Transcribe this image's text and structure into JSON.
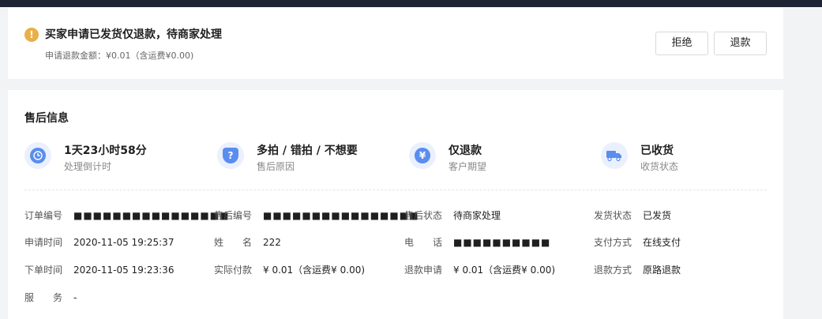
{
  "alert": {
    "title": "买家申请已发货仅退款，待商家处理",
    "amount": "申请退款金额：¥0.01（含运费¥0.00)",
    "reject_label": "拒绝",
    "refund_label": "退款"
  },
  "info": {
    "title": "售后信息",
    "stats": [
      {
        "main": "1天23小时58分",
        "sub": "处理倒计时",
        "icon": "clock-icon"
      },
      {
        "main": "多拍 / 错拍 / 不想要",
        "sub": "售后原因",
        "icon": "shield-question-icon"
      },
      {
        "main": "仅退款",
        "sub": "客户期望",
        "icon": "yuan-refund-icon"
      },
      {
        "main": "已收货",
        "sub": "收货状态",
        "icon": "truck-icon"
      }
    ],
    "fields": {
      "order_no": {
        "label": "订单编号",
        "value": "■■■■■■■■■■■■■■■■"
      },
      "aftersale_no": {
        "label": "售后编号",
        "value": "■■■■■■■■■■■■■■■■"
      },
      "aftersale_status": {
        "label": "售后状态",
        "value": "待商家处理"
      },
      "ship_status": {
        "label": "发货状态",
        "value": "已发货"
      },
      "apply_time": {
        "label": "申请时间",
        "value": "2020-11-05 19:25:37"
      },
      "name": {
        "label": "姓　　名",
        "value": "222"
      },
      "phone": {
        "label": "电　　话",
        "value": "■■■■■■■■■■"
      },
      "pay_method": {
        "label": "支付方式",
        "value": "在线支付"
      },
      "order_time": {
        "label": "下单时间",
        "value": "2020-11-05 19:23:36"
      },
      "paid": {
        "label": "实际付款",
        "value": "¥ 0.01（含运费¥ 0.00)"
      },
      "refund_apply": {
        "label": "退款申请",
        "value": "¥ 0.01（含运费¥ 0.00)"
      },
      "refund_method": {
        "label": "退款方式",
        "value": "原路退款"
      },
      "service": {
        "label": "服　　务",
        "value": "-"
      }
    }
  },
  "colors": {
    "accent": "#5a8dee",
    "warning": "#e8b04a",
    "topbar": "#1e2433"
  }
}
